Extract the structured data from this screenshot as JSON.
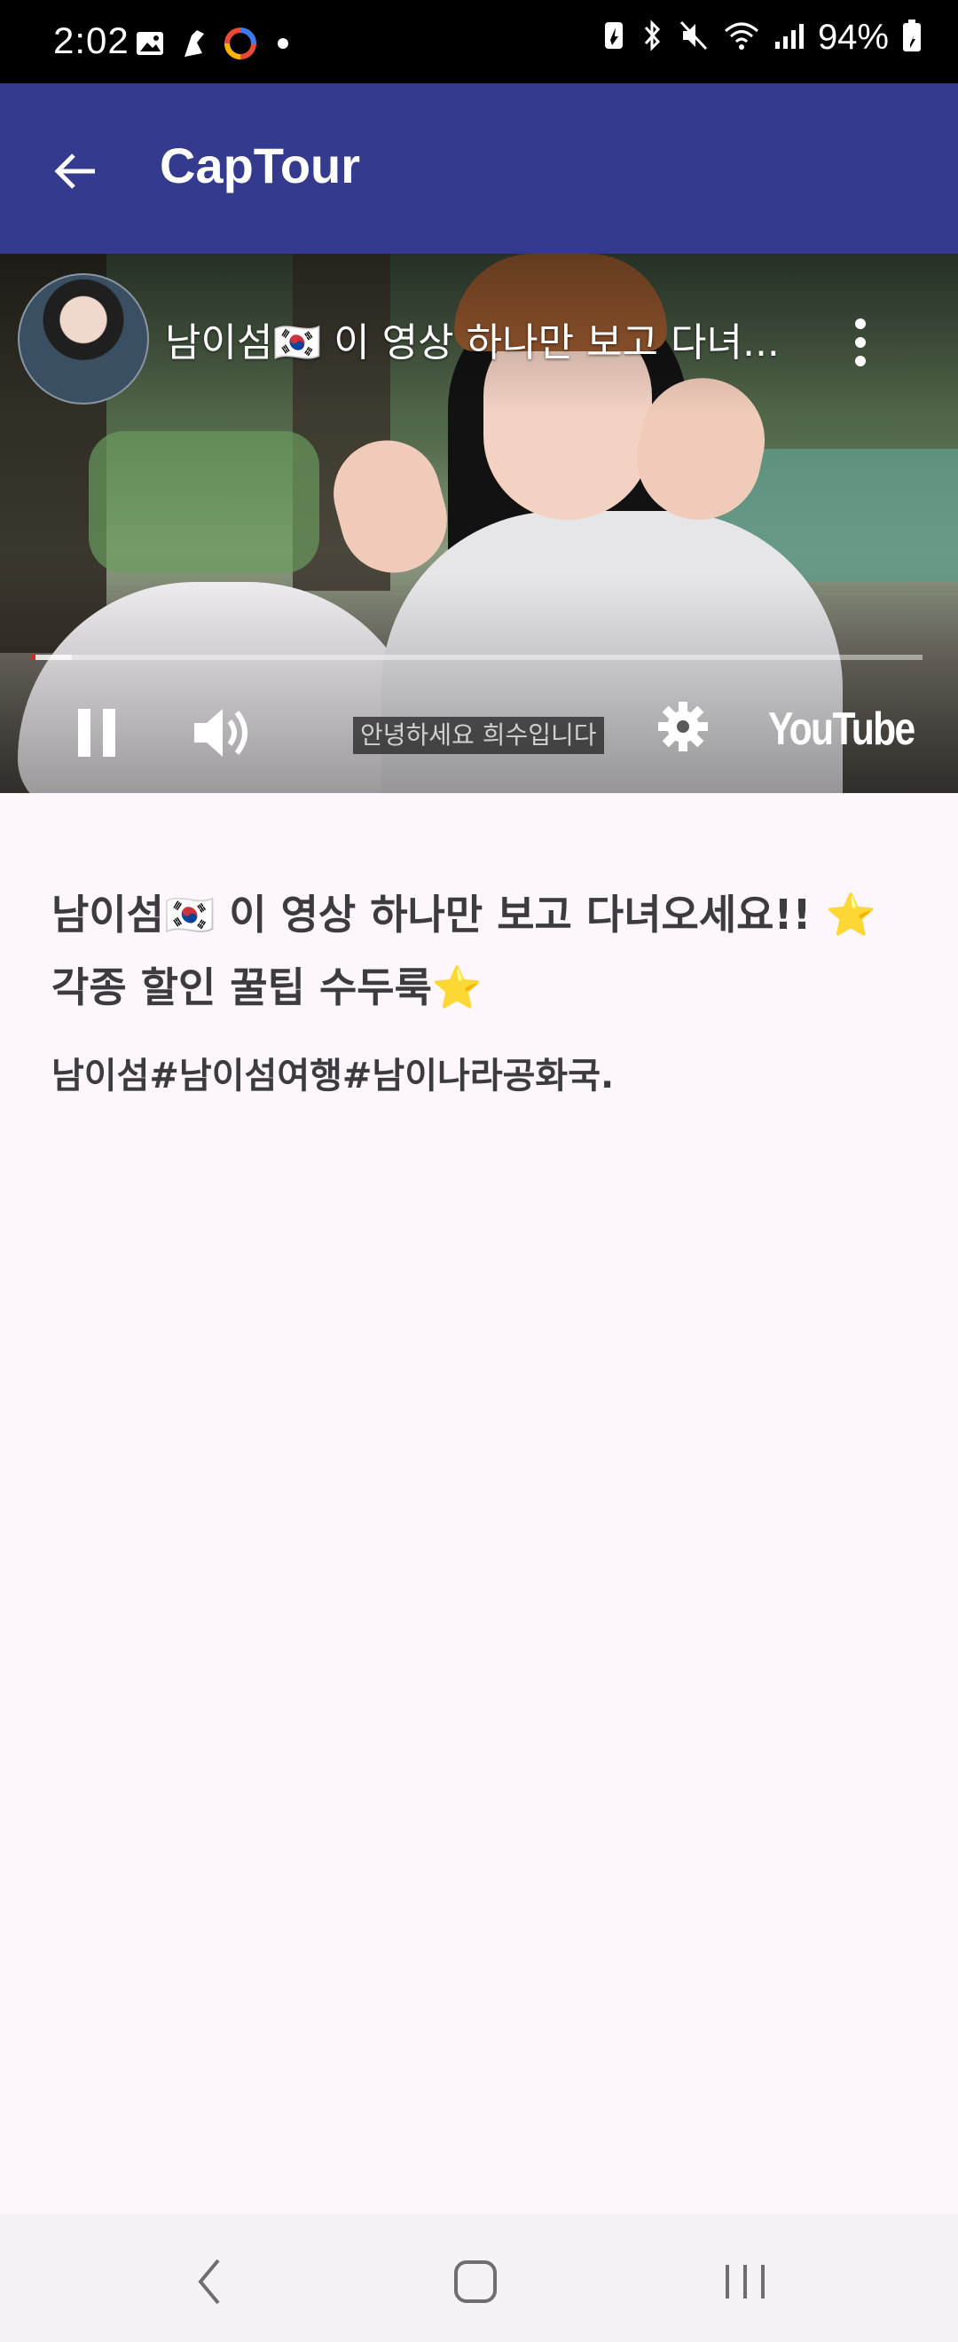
{
  "status_bar": {
    "time": "2:02",
    "battery_percent": "94%",
    "left_icons": [
      "image-icon",
      "app-notification-icon",
      "browser-app-icon",
      "dot-icon"
    ],
    "right_icons": [
      "battery-saver-icon",
      "bluetooth-icon",
      "mute-icon",
      "wifi-icon",
      "signal-icon",
      "battery-icon"
    ]
  },
  "app_bar": {
    "title": "CapTour",
    "back_icon": "arrow-left-icon",
    "color": "#343a8d"
  },
  "video": {
    "title": "남이섬🇰🇷 이 영상 하나만 보고 다녀...",
    "caption": "안녕하세요 희수입니다",
    "progress_fraction": 0.004,
    "buffered_fraction": 0.045,
    "logo": "YouTube",
    "accent_color": "#e62117"
  },
  "content": {
    "headline": "남이섬🇰🇷 이 영상 하나만 보고 다녀오세요!! ⭐각종 할인 꿀팁 수두룩⭐",
    "hashtags": "남이섬#남이섬여행#남이나라공화국."
  }
}
